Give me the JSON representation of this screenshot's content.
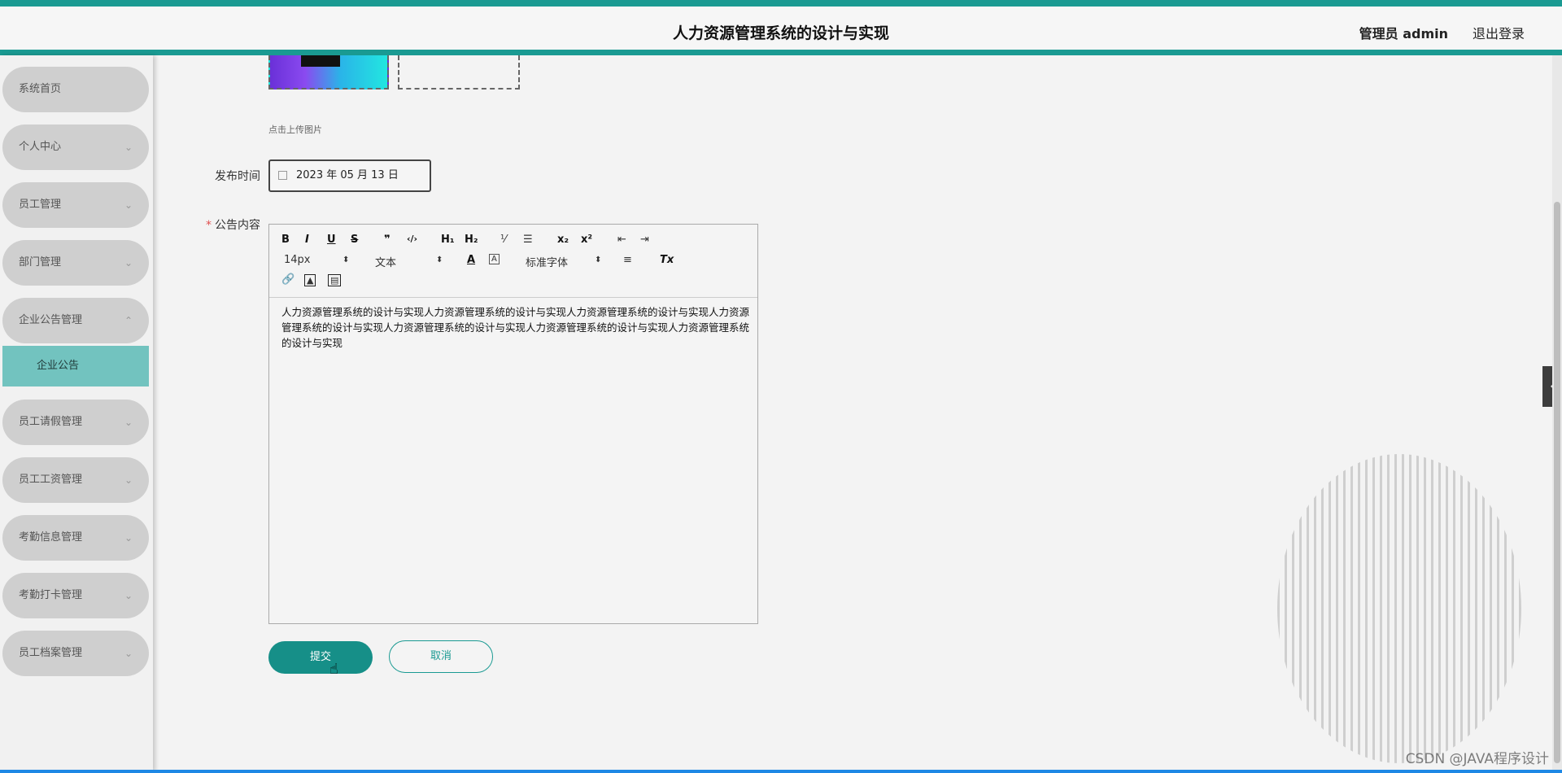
{
  "header": {
    "title": "人力资源管理系统的设计与实现",
    "user_label": "管理员 admin",
    "logout_label": "退出登录"
  },
  "sidebar": {
    "items": [
      {
        "label": "系统首页",
        "has_chevron": false
      },
      {
        "label": "个人中心",
        "has_chevron": true
      },
      {
        "label": "员工管理",
        "has_chevron": true
      },
      {
        "label": "部门管理",
        "has_chevron": true
      },
      {
        "label": "企业公告管理",
        "has_chevron": true,
        "expanded": true
      },
      {
        "label": "员工请假管理",
        "has_chevron": true
      },
      {
        "label": "员工工资管理",
        "has_chevron": true
      },
      {
        "label": "考勤信息管理",
        "has_chevron": true
      },
      {
        "label": "考勤打卡管理",
        "has_chevron": true
      },
      {
        "label": "员工档案管理",
        "has_chevron": true
      }
    ],
    "sub_items": [
      {
        "label": "企业公告",
        "active": true
      }
    ]
  },
  "form": {
    "upload_tip": "点击上传图片",
    "publish_time_label": "发布时间",
    "publish_time_value": "2023 年 05 月 13 日",
    "content_label": "公告内容",
    "content_required_mark": "*",
    "content_text": "人力资源管理系统的设计与实现人力资源管理系统的设计与实现人力资源管理系统的设计与实现人力资源管理系统的设计与实现人力资源管理系统的设计与实现人力资源管理系统的设计与实现人力资源管理系统的设计与实现",
    "submit_label": "提交",
    "cancel_label": "取消"
  },
  "editor_toolbar": {
    "bold": "B",
    "italic": "I",
    "underline": "U",
    "strike": "S",
    "quote": "❞",
    "code": "‹/›",
    "h1": "H₁",
    "h2": "H₂",
    "ordered_list": "⅟",
    "bullet_list": "☰",
    "subscript": "x₂",
    "superscript": "x²",
    "outdent": "⇤",
    "indent": "⇥",
    "size_value": "14px",
    "header_value": "文本",
    "color": "A",
    "background": "A",
    "font_value": "标准字体",
    "align": "≡",
    "clean": "Tx"
  },
  "side_toggle": "‹",
  "watermark": "CSDN @JAVA程序设计",
  "colors": {
    "accent": "#1a9a92",
    "submit": "#168f88",
    "active_sub": "#72c3bf"
  }
}
